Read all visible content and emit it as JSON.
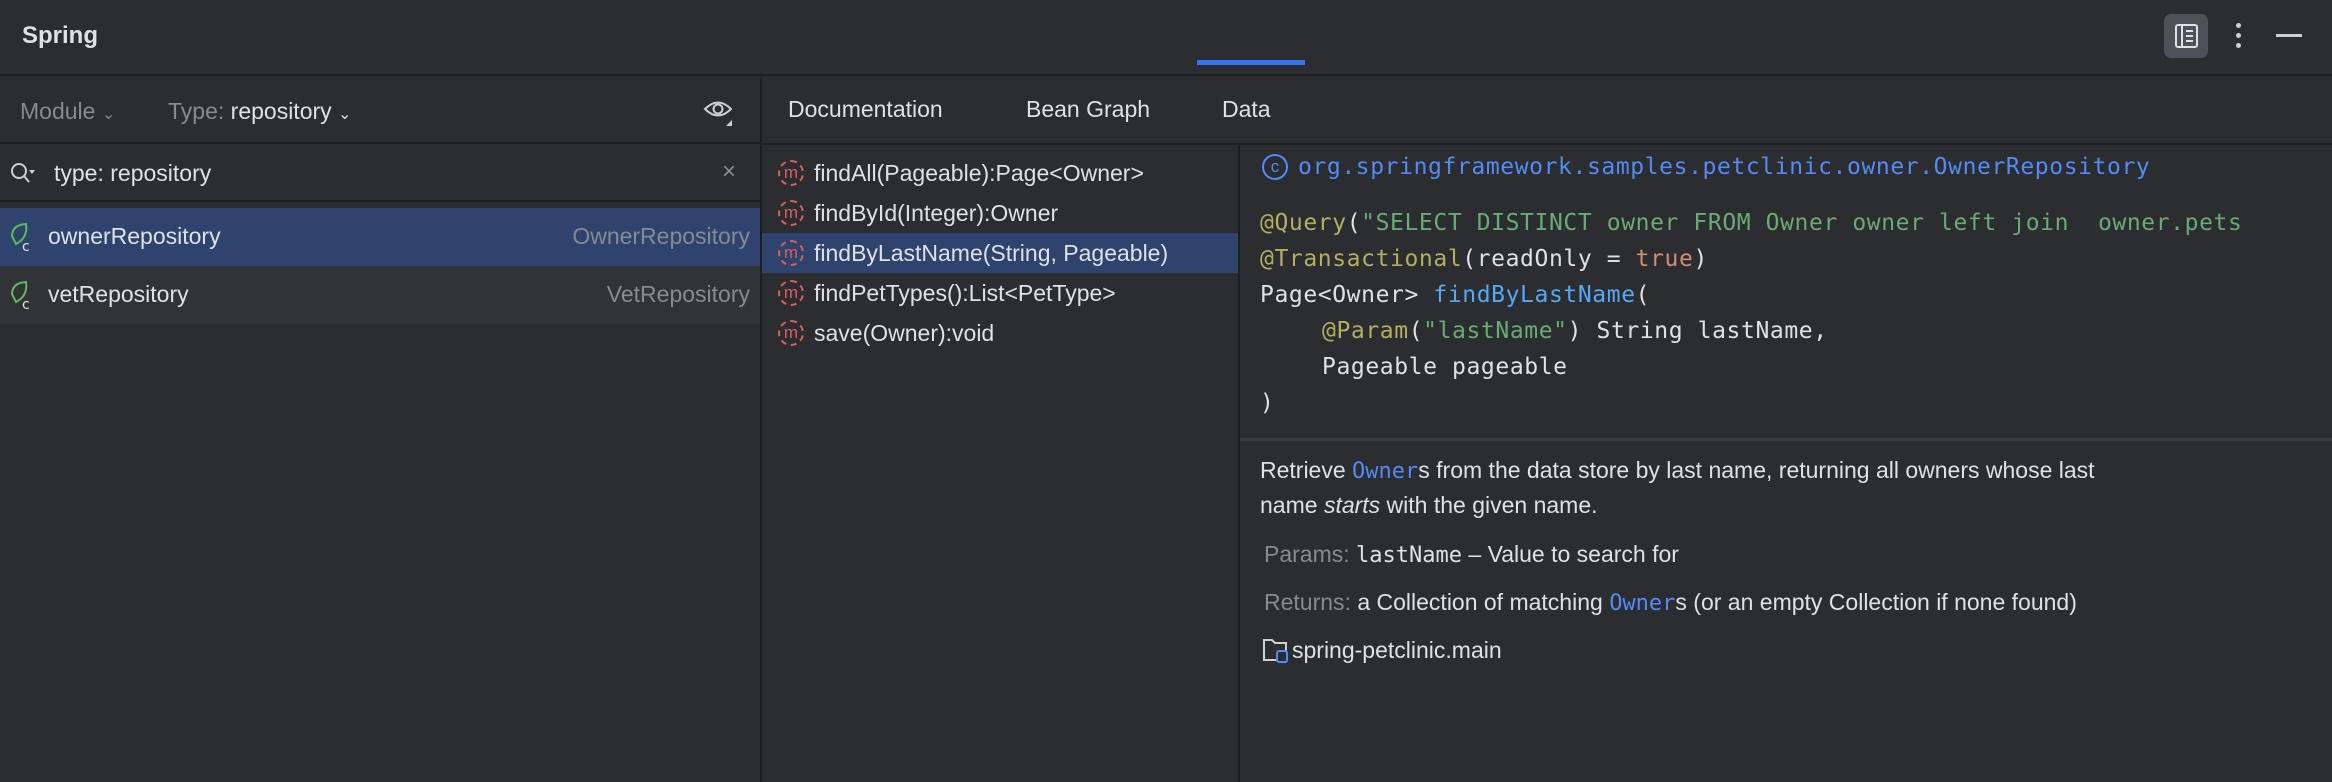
{
  "title": "Spring",
  "filters": {
    "module_label": "Module",
    "type_label": "Type:",
    "type_value": "repository"
  },
  "search": {
    "value": "type: repository"
  },
  "beans": [
    {
      "name": "ownerRepository",
      "type": "OwnerRepository",
      "selected": true
    },
    {
      "name": "vetRepository",
      "type": "VetRepository",
      "selected": false
    }
  ],
  "tabs": [
    {
      "label": "Documentation"
    },
    {
      "label": "Bean Graph"
    },
    {
      "label": "Data",
      "active": true
    }
  ],
  "methods": [
    "findAll(Pageable):Page<Owner>",
    "findById(Integer):Owner",
    "findByLastName(String, Pageable)",
    "findPetTypes():List<PetType>",
    "save(Owner):void"
  ],
  "doc": {
    "class_fqn": "org.springframework.samples.petclinic.owner.OwnerRepository",
    "code": {
      "query_ann": "@Query",
      "query_str": "\"SELECT DISTINCT owner FROM Owner owner left join  owner.pets",
      "tx_ann": "@Transactional",
      "tx_open": "(readOnly = ",
      "tx_val": "true",
      "tx_close": ")",
      "ret_type": "Page<Owner> ",
      "method": "findByLastName",
      "paren": "(",
      "param_ann": "@Param",
      "param_open": "(",
      "param_str": "\"lastName\"",
      "param_rest": ") String lastName,",
      "pageable": "Pageable pageable",
      "close": ")"
    },
    "desc_1": "Retrieve ",
    "desc_link": "Owner",
    "desc_2": "s from the data store by last name, returning all owners whose last",
    "desc_3": "name ",
    "desc_em": "starts",
    "desc_4": " with the given name.",
    "params_label": "Params:",
    "params_name": "lastName",
    "params_desc": " – Value to search for",
    "returns_label": "Returns:",
    "returns_1": "a Collection of matching ",
    "returns_link": "Owner",
    "returns_2": "s (or an empty Collection if none found)",
    "module": "spring-petclinic.main"
  }
}
